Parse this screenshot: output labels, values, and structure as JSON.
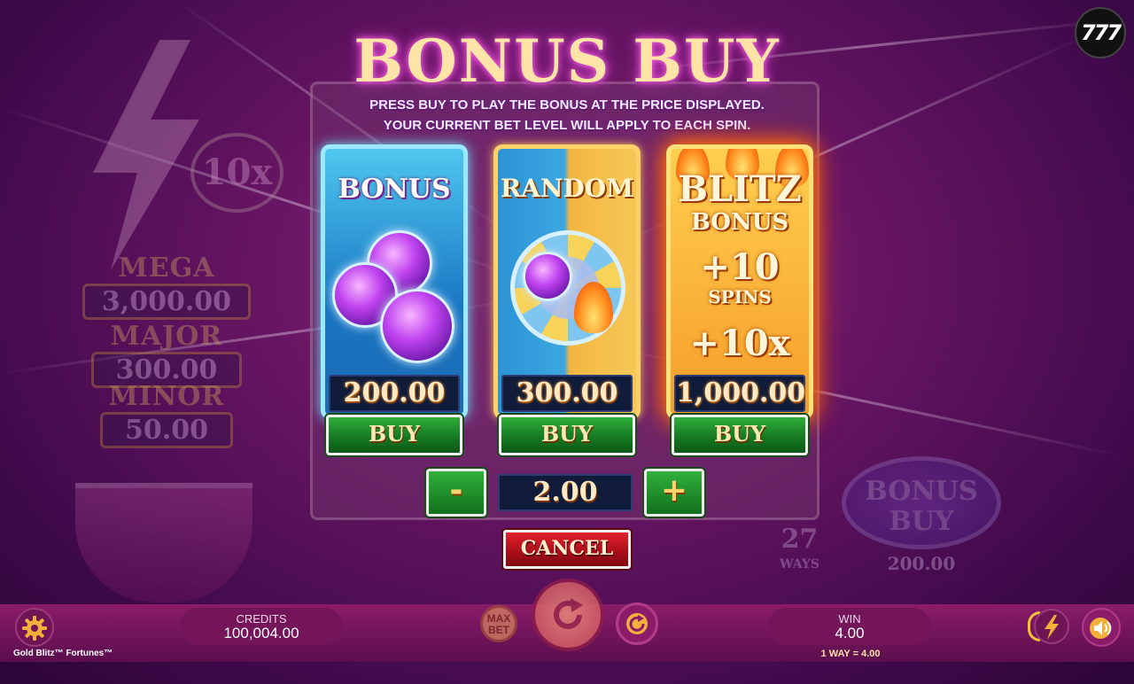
{
  "modal": {
    "title": "BONUS BUY",
    "instructions_line1": "PRESS BUY TO PLAY THE BONUS AT THE PRICE DISPLAYED.",
    "instructions_line2": "YOUR CURRENT BET LEVEL WILL APPLY TO EACH SPIN.",
    "options": [
      {
        "name": "BONUS",
        "price": "200.00",
        "buy_label": "BUY"
      },
      {
        "name": "RANDOM",
        "price": "300.00",
        "buy_label": "BUY"
      },
      {
        "name_line1": "BLITZ",
        "name_line2": "BONUS",
        "feature_1": "+10",
        "feature_1_unit": "SPINS",
        "feature_2": "+10x",
        "price": "1,000.00",
        "buy_label": "BUY"
      }
    ],
    "bet": {
      "decrease_label": "-",
      "value": "2.00",
      "increase_label": "+"
    },
    "cancel_label": "CANCEL"
  },
  "background": {
    "multiplier": "10x",
    "jackpots": [
      {
        "label": "MEGA",
        "value": "3,000.00"
      },
      {
        "label": "MAJOR",
        "value": "300.00"
      },
      {
        "label": "MINOR",
        "value": "50.00"
      }
    ],
    "bonus_buy_badge": "BONUS BUY",
    "bonus_buy_price": "200.00",
    "ways_count": "27",
    "ways_label": "WAYS"
  },
  "brand": {
    "logo_text": "777"
  },
  "bottom_bar": {
    "credits_label": "CREDITS",
    "credits_value": "100,004.00",
    "max_bet_label": "MAX BET",
    "win_label": "WIN",
    "win_value": "4.00",
    "ways_info": "1 WAY = 4.00",
    "game_name": "Gold Blitz™ Fortunes™"
  },
  "icons": {
    "settings": "gear-icon",
    "spin": "spin-arrow-icon",
    "autoplay": "autoplay-icon",
    "turbo": "lightning-bolt-icon",
    "sound": "speaker-icon"
  },
  "colors": {
    "buy_green": "#167a22",
    "cancel_red": "#a80d18",
    "price_panel": "#101c3a",
    "title_gold": "#ffe4a8"
  }
}
